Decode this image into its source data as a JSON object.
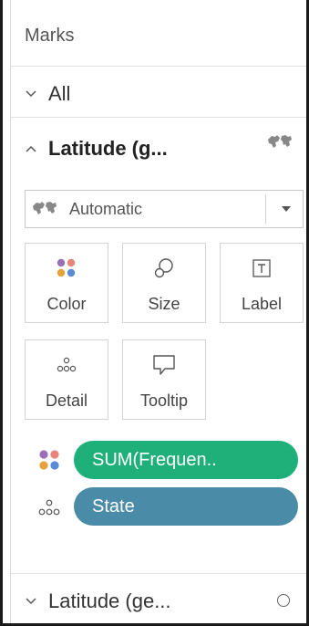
{
  "marks": {
    "header": "Marks",
    "all_label": "All",
    "layer_label": "Latitude (g...",
    "mark_type": {
      "selected": "Automatic"
    },
    "cards": [
      {
        "label": "Color",
        "icon": "color-dots-icon"
      },
      {
        "label": "Size",
        "icon": "size-icon"
      },
      {
        "label": "Label",
        "icon": "text-label-icon"
      },
      {
        "label": "Detail",
        "icon": "detail-dots-icon"
      },
      {
        "label": "Tooltip",
        "icon": "tooltip-icon"
      }
    ],
    "pills": [
      {
        "label": "SUM(Frequen..",
        "encoding": "color",
        "color": "#1fb07a"
      },
      {
        "label": "State",
        "encoding": "detail",
        "color": "#4a8ba8"
      }
    ],
    "bottom_layer_label": "Latitude (ge..."
  },
  "colors": {
    "color_dots": [
      "#9b6fb6",
      "#e8857a",
      "#e8a23d",
      "#5b8bd6"
    ]
  }
}
